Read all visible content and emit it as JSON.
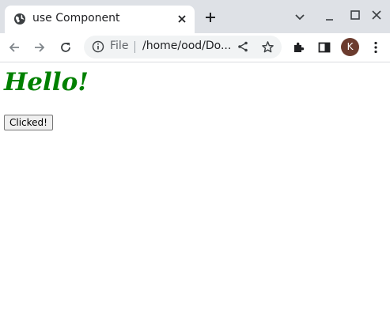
{
  "browser": {
    "tab": {
      "title": "use Component"
    },
    "address_bar": {
      "scheme_label": "File",
      "url": "/home/ood/Do..."
    },
    "profile": {
      "initial": "K"
    }
  },
  "page": {
    "heading": "Hello!",
    "button_label": "Clicked!"
  },
  "colors": {
    "heading": "#008000",
    "tabstrip": "#dee1e6",
    "avatar": "#6b3b2e"
  }
}
